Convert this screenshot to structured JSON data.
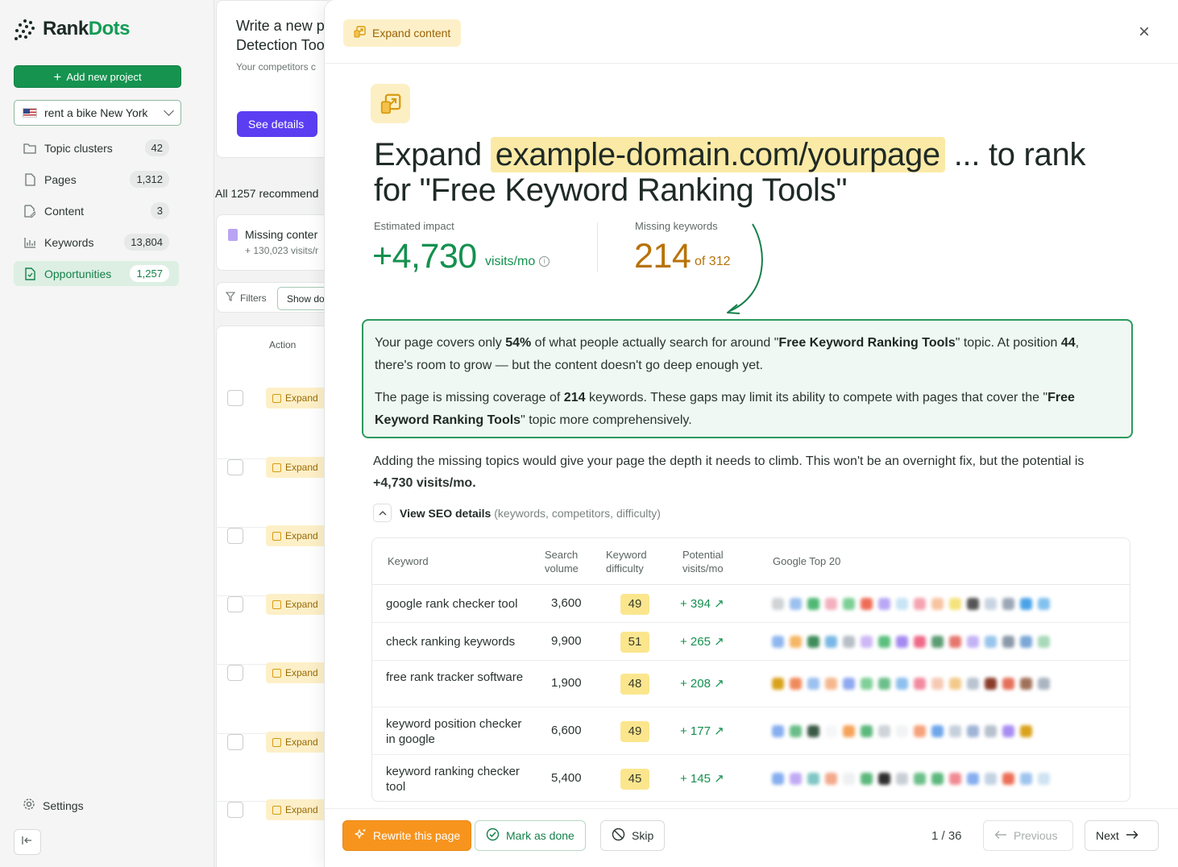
{
  "brand": {
    "name_a": "Rank",
    "name_b": "Dots"
  },
  "sidebar": {
    "add_project_label": "Add new project",
    "project": "rent a bike New York",
    "items": [
      {
        "label": "Topic clusters",
        "count": "42",
        "icon": "folder-icon"
      },
      {
        "label": "Pages",
        "count": "1,312",
        "icon": "page-icon"
      },
      {
        "label": "Content",
        "count": "3",
        "icon": "content-icon"
      },
      {
        "label": "Keywords",
        "count": "13,804",
        "icon": "chart-icon"
      },
      {
        "label": "Opportunities",
        "count": "1,257",
        "icon": "opportunity-icon"
      }
    ],
    "settings_label": "Settings"
  },
  "background": {
    "card_title_line1": "Write a new p",
    "card_title_line2": "Detection Too",
    "card_sub": "Your competitors c",
    "see_details": "See details",
    "all_recs": "All 1257 recommend",
    "missing_title": "Missing conter",
    "missing_sub": "+ 130,023 visits/r",
    "filters": "Filters",
    "show": "Show do",
    "action_header": "Action",
    "expand_label": "Expand"
  },
  "modal": {
    "header_pill": "Expand content",
    "headline_pre": "Expand ",
    "headline_domain": "example-domain.com/yourpage",
    "headline_post": " ... to rank for \"Free Keyword Ranking Tools\"",
    "impact_label": "Estimated impact",
    "impact_value": "+4,730",
    "impact_unit": "visits/mo",
    "missing_label": "Missing keywords",
    "missing_value": "214",
    "missing_of": "of 312",
    "box_p1_a": "Your page covers only ",
    "box_p1_pct": "54%",
    "box_p1_b": " of what people actually search for around  \"",
    "box_p1_topic": "Free Keyword Ranking Tools",
    "box_p1_c": "\" topic. At position ",
    "box_p1_pos": "44",
    "box_p1_d": ", there's room to grow — but the content doesn't go deep enough yet.",
    "box_p2_a": "The page is missing coverage of ",
    "box_p2_num": "214",
    "box_p2_b": " keywords. These gaps may limit its ability to compete with pages that cover the \"",
    "box_p2_topic": "Free Keyword Ranking Tools",
    "box_p2_c": "\" topic more comprehensively.",
    "para_a": "Adding the missing topics would give your page the depth it needs to climb. This won't be an overnight fix, but the potential is ",
    "para_b": "+4,730 visits/mo.",
    "seo_toggle": "View SEO details",
    "seo_toggle_hint": "(keywords, competitors, difficulty)",
    "table": {
      "headers": {
        "keyword": "Keyword",
        "volume_1": "Search",
        "volume_2": "volume",
        "difficulty_1": "Keyword",
        "difficulty_2": "difficulty",
        "potential_1": "Potential",
        "potential_2": "visits/mo",
        "top20": "Google Top 20"
      },
      "rows": [
        {
          "keyword": "google rank checker tool",
          "volume": "3,600",
          "difficulty": "49",
          "potential": "+ 394 ↗"
        },
        {
          "keyword": "check ranking keywords",
          "volume": "9,900",
          "difficulty": "51",
          "potential": "+ 265 ↗"
        },
        {
          "keyword": "free rank tracker software",
          "volume": "1,900",
          "difficulty": "48",
          "potential": "+ 208 ↗"
        },
        {
          "keyword": "keyword position checker in google",
          "volume": "6,600",
          "difficulty": "49",
          "potential": "+ 177 ↗"
        },
        {
          "keyword": "keyword ranking checker tool",
          "volume": "5,400",
          "difficulty": "45",
          "potential": "+ 145 ↗"
        }
      ]
    },
    "buttons": {
      "rewrite": "Rewrite this page",
      "done": "Mark as done",
      "skip": "Skip",
      "prev": "Previous",
      "next": "Next"
    },
    "pager": "1 / 36"
  },
  "colors": {
    "accent_green": "#14904f",
    "amber": "#b87208",
    "purple": "#5b3ef2",
    "orange": "#f7941d"
  }
}
